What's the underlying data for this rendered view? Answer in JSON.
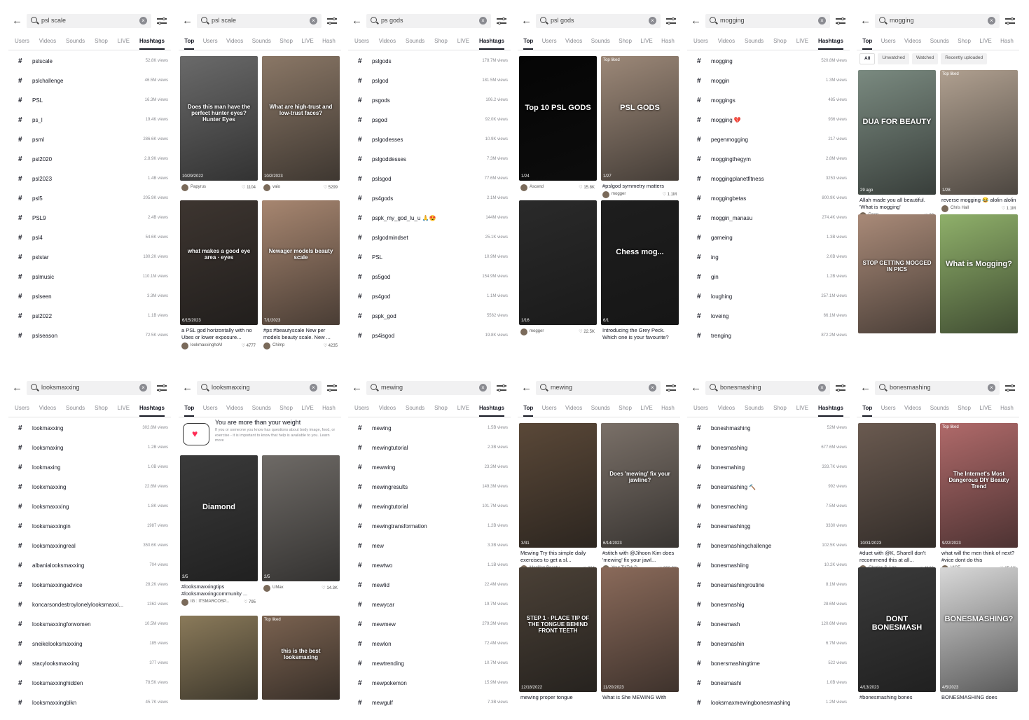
{
  "panels": [
    {
      "query": "psl scale",
      "tabs": [
        "Users",
        "Videos",
        "Sounds",
        "Shop",
        "LIVE",
        "Hashtags"
      ],
      "active": "Hashtags",
      "type": "hashtags",
      "rows": [
        [
          "pslscale",
          "52.8K views"
        ],
        [
          "pslchallenge",
          "46.5M views"
        ],
        [
          "PSL",
          "16.3M views"
        ],
        [
          "ps_l",
          "19.4K views"
        ],
        [
          "psml",
          "286.6K views"
        ],
        [
          "psl2020",
          "2.8.9K views"
        ],
        [
          "psl2023",
          "1.4B views"
        ],
        [
          "psl5",
          "205.9K views"
        ],
        [
          "PSL9",
          "2.4B views"
        ],
        [
          "psl4",
          "54.6K views"
        ],
        [
          "pslstar",
          "180.2K views"
        ],
        [
          "pslmusic",
          "110.1M views"
        ],
        [
          "pslseen",
          "3.3M views"
        ],
        [
          "psl2022",
          "1.1B views"
        ],
        [
          "pslseason",
          "72.5K views"
        ]
      ]
    },
    {
      "query": "psl scale",
      "tabs": [
        "Top",
        "Users",
        "Videos",
        "Sounds",
        "Shop",
        "LIVE",
        "Hash"
      ],
      "active": "Top",
      "type": "top",
      "cards": [
        {
          "ov": "Does this man have the perfect hunter eyes? Hunter Eyes",
          "date": "10/29/2022",
          "cap": "",
          "author": "Papyrus",
          "likes": "1104",
          "bg": "#6a6a6a"
        },
        {
          "ov": "What are high-trust and low-trust faces?",
          "date": "10/2/2023",
          "cap": "",
          "author": "vaio",
          "likes": "5299",
          "bg": "#8a7766"
        },
        {
          "ov": "what makes a good eye area · eyes",
          "date": "6/15/2023",
          "cap": "a PSL god horizontally with no Ubes or lower exposure...",
          "author": "lookmaxxinghoM",
          "likes": "4777",
          "bg": "#3d3530"
        },
        {
          "ov": "Newager models beauty scale",
          "date": "7/1/2023",
          "cap": "#ps #beautyscale New per models beauty scale. New ...",
          "author": "Chimp",
          "likes": "4235",
          "bg": "#a78670"
        }
      ]
    },
    {
      "query": "ps gods",
      "tabs": [
        "Users",
        "Videos",
        "Sounds",
        "Shop",
        "LIVE",
        "Hashtags"
      ],
      "active": "Hashtags",
      "type": "hashtags",
      "rows": [
        [
          "pslgods",
          "178.7M views"
        ],
        [
          "pslgod",
          "181.5M views"
        ],
        [
          "psgods",
          "106.2 views"
        ],
        [
          "psgod",
          "92.0K views"
        ],
        [
          "pslgodesses",
          "10.9K views"
        ],
        [
          "pslgoddesses",
          "7.3M views"
        ],
        [
          "pslsgod",
          "77.6M views"
        ],
        [
          "ps4gods",
          "2.1M views"
        ],
        [
          "pspk_my_god_lu_u 🙏😍",
          "144M views"
        ],
        [
          "pslgodmindset",
          "25.1K views"
        ],
        [
          "PSL",
          "10.9M views"
        ],
        [
          "ps5god",
          "154.9M views"
        ],
        [
          "ps4god",
          "1.1M views"
        ],
        [
          "pspk_god",
          "5562 views"
        ],
        [
          "ps4isgod",
          "19.8K views"
        ]
      ]
    },
    {
      "query": "psl gods",
      "tabs": [
        "Top",
        "Users",
        "Videos",
        "Sounds",
        "Shop",
        "LIVE",
        "Hash"
      ],
      "active": "Top",
      "type": "top",
      "cards": [
        {
          "ov": "Top 10 PSL GODS",
          "date": "1/24",
          "cap": "",
          "author": "Ascend",
          "likes": "15.8K",
          "bg": "#050505"
        },
        {
          "ov": "PSL GODS",
          "date": "1/27",
          "cap": "#pslgod symmetry matters",
          "author": "mogger",
          "likes": "1.1M",
          "bg": "#9c8878",
          "top": "Top liked"
        },
        {
          "ov": "",
          "date": "1/16",
          "cap": "",
          "author": "mogger",
          "likes": "22.5K",
          "bg": "#2a2a2a"
        },
        {
          "ov": "Chess mog...",
          "date": "6/1",
          "cap": "Introducing the Grey Peck. Which one is your favourite?",
          "author": "",
          "likes": "",
          "bg": "#1e1e1e"
        }
      ]
    },
    {
      "query": "mogging",
      "tabs": [
        "Users",
        "Videos",
        "Sounds",
        "Shop",
        "LIVE",
        "Hashtags"
      ],
      "active": "Hashtags",
      "type": "hashtags",
      "rows": [
        [
          "mogging",
          "520.8M views"
        ],
        [
          "moggin",
          "1.3M views"
        ],
        [
          "moggings",
          "485 views"
        ],
        [
          "mogging 💔",
          "936 views"
        ],
        [
          "pegenmogging",
          "217 views"
        ],
        [
          "moggingthegym",
          "2.8M views"
        ],
        [
          "moggingplanetfitness",
          "3253 views"
        ],
        [
          "moggingbetas",
          "800.9K views"
        ],
        [
          "moggin_manasu",
          "274.4K views"
        ],
        [
          "gameing",
          "1.3B views"
        ],
        [
          "ing",
          "2.0B views"
        ],
        [
          "gin",
          "1.2B views"
        ],
        [
          "loughing",
          "257.1M views"
        ],
        [
          "loveing",
          "66.1M views"
        ],
        [
          "trenging",
          "872.2M views"
        ]
      ]
    },
    {
      "query": "mogging",
      "tabs": [
        "Top",
        "Users",
        "Videos",
        "Sounds",
        "Shop",
        "LIVE",
        "Hash"
      ],
      "active": "Top",
      "type": "top",
      "chips": [
        "All",
        "Unwatched",
        "Watched",
        "Recently uploaded"
      ],
      "cards": [
        {
          "ov": "DUA FOR BEAUTY",
          "date": "29 ago",
          "cap": "Allah made you all beautiful. 'What is mogging'",
          "author": "Deen",
          "likes": "22",
          "bg": "#7a8a80"
        },
        {
          "ov": "",
          "date": "1/28",
          "cap": "reverse mogging 😂 alolin alolin",
          "author": "Chris Hall",
          "likes": "1.1M",
          "bg": "#b0a090",
          "top": "Top liked"
        },
        {
          "ov": "STOP GETTING MOGGED IN PICS",
          "date": "",
          "cap": "",
          "author": "",
          "likes": "",
          "bg": "#a98a78"
        },
        {
          "ov": "What is Mogging?",
          "date": "",
          "cap": "",
          "author": "",
          "likes": "",
          "bg": "#8fb06a"
        }
      ]
    },
    {
      "query": "looksmaxxing",
      "tabs": [
        "Users",
        "Videos",
        "Sounds",
        "Shop",
        "LIVE",
        "Hashtags"
      ],
      "active": "Hashtags",
      "type": "hashtags",
      "rows": [
        [
          "lookmaxxing",
          "302.6M views"
        ],
        [
          "looksmaxing",
          "1.2B views"
        ],
        [
          "lookmaxing",
          "1.0B views"
        ],
        [
          "lookxmaxxing",
          "22.6M views"
        ],
        [
          "looksmaxxxing",
          "1.8K views"
        ],
        [
          "looksmaxxingin",
          "1987 views"
        ],
        [
          "looksmaxxingreal",
          "350.6K views"
        ],
        [
          "albanialooksmaxxing",
          "704 views"
        ],
        [
          "looksmaxxingadvice",
          "28.2K views"
        ],
        [
          "koncarsondestroylonelylooksmaxxi...",
          "1362 views"
        ],
        [
          "looksmaxxingforwomen",
          "10.5M views"
        ],
        [
          "sneikelooksmaxxing",
          "185 views"
        ],
        [
          "stacylooksmaxxing",
          "377 views"
        ],
        [
          "looksmaxxinghidden",
          "78.5K views"
        ],
        [
          "looksmaxxingblkn",
          "45.7K views"
        ]
      ]
    },
    {
      "query": "looksmaxxing",
      "tabs": [
        "Top",
        "Users",
        "Videos",
        "Sounds",
        "Shop",
        "LIVE",
        "Hash"
      ],
      "active": "Top",
      "type": "top",
      "weight": [
        "You are more than your weight",
        "If you or someone you know has questions about body image, food, or exercise - it is important to know that help is available to you. Learn more"
      ],
      "cards": [
        {
          "ov": "Diamond",
          "date": "3/5",
          "cap": "#looksmaxxingtips #looksmaxxingcommunity ...",
          "author": "IG : ITSMARCOSP...",
          "likes": "795",
          "bg": "#3a3a3a"
        },
        {
          "ov": "",
          "date": "2/5",
          "cap": "",
          "author": "UMax",
          "likes": "14.3K",
          "bg": "#6e6a66"
        },
        {
          "ov": "",
          "date": "",
          "cap": "",
          "author": "",
          "likes": "",
          "bg": "#8a7a5a"
        },
        {
          "ov": "this is the best looksmaxing",
          "date": "",
          "cap": "",
          "author": "",
          "likes": "",
          "bg": "#7a6250",
          "top": "Top liked"
        }
      ]
    },
    {
      "query": "mewing",
      "tabs": [
        "Users",
        "Videos",
        "Sounds",
        "Shop",
        "LIVE",
        "Hashtags"
      ],
      "active": "Hashtags",
      "type": "hashtags",
      "rows": [
        [
          "mewing",
          "1.5B views"
        ],
        [
          "mewingtutorial",
          "2.3B views"
        ],
        [
          "mewwing",
          "23.3M views"
        ],
        [
          "mewingresults",
          "149.3M views"
        ],
        [
          "mewingtutorial",
          "101.7M views"
        ],
        [
          "mewingtransformation",
          "1.2B views"
        ],
        [
          "mew",
          "3.3B views"
        ],
        [
          "mewtwo",
          "1.1B views"
        ],
        [
          "mewlid",
          "22.4M views"
        ],
        [
          "mewycar",
          "19.7M views"
        ],
        [
          "mewmew",
          "279.3M views"
        ],
        [
          "mewlon",
          "72.4M views"
        ],
        [
          "mewtrending",
          "10.7M views"
        ],
        [
          "mewpokemon",
          "15.9M views"
        ],
        [
          "mewgulf",
          "7.3B views"
        ]
      ]
    },
    {
      "query": "mewing",
      "tabs": [
        "Top",
        "Users",
        "Videos",
        "Sounds",
        "Shop",
        "LIVE",
        "Hash"
      ],
      "active": "Top",
      "type": "top",
      "cards": [
        {
          "ov": "",
          "date": "3/31",
          "cap": "Mewing Try this simple daily exercises to get a sl...",
          "author": "Magillan Beauty...",
          "likes": "234",
          "bg": "#5a4838"
        },
        {
          "ov": "Does 'mewing' fix your jawline?",
          "date": "6/14/2023",
          "cap": "#stitch with @Jihoon Kim does 'mewing' fix your jawl...",
          "author": "Your TikTok D...",
          "likes": "306.9K",
          "bg": "#7a7068"
        },
        {
          "ov": "STEP 1 · PLACE TIP OF THE TONGUE BEHIND FRONT TEETH",
          "date": "12/18/2022",
          "cap": "mewing proper tongue",
          "author": "",
          "likes": "",
          "bg": "#4a4036"
        },
        {
          "ov": "",
          "date": "11/20/2023",
          "cap": "What is She MEWING With",
          "author": "",
          "likes": "",
          "bg": "#8a6a5a"
        }
      ]
    },
    {
      "query": "bonesmashing",
      "tabs": [
        "Users",
        "Videos",
        "Sounds",
        "Shop",
        "LIVE",
        "Hashtags"
      ],
      "active": "Hashtags",
      "type": "hashtags",
      "rows": [
        [
          "boneshmashing",
          "52M views"
        ],
        [
          "bonesmashing",
          "677.6M views"
        ],
        [
          "bonesmahing",
          "333.7K views"
        ],
        [
          "bonesmashing 🔨",
          "992 views"
        ],
        [
          "bonesmaching",
          "7.5M views"
        ],
        [
          "bonesmashingg",
          "3330 views"
        ],
        [
          "bonesmashingchallenge",
          "102.5K views"
        ],
        [
          "bonesmashiing",
          "10.2K views"
        ],
        [
          "bonesmashingroutine",
          "8.1M views"
        ],
        [
          "bonesmashig",
          "28.6M views"
        ],
        [
          "bonesmash",
          "120.6M views"
        ],
        [
          "bonesmashin",
          "6.7M views"
        ],
        [
          "bonersmashingtime",
          "522 views"
        ],
        [
          "bonesmashi",
          "1.0B views"
        ],
        [
          "looksmaxmewingbonesmashing",
          "1.2M views"
        ]
      ]
    },
    {
      "query": "bonesmashing",
      "tabs": [
        "Top",
        "Users",
        "Videos",
        "Sounds",
        "Shop",
        "LIVE",
        "Hash"
      ],
      "active": "Top",
      "type": "top",
      "cards": [
        {
          "ov": "",
          "date": "10/31/2023",
          "cap": "#duet with @K, Sharell don't recommend this at all...",
          "author": "Charles S. Loo...",
          "likes": "4166",
          "bg": "#6a5a50"
        },
        {
          "ov": "The Internet's Most Dangerous DIY Beauty Trend",
          "date": "9/22/2023",
          "cap": "what will the men think of next? #vice dont do this",
          "author": "VICE",
          "likes": "15.1K",
          "bg": "#b06a6a",
          "top": "Top liked"
        },
        {
          "ov": "DONT BONESMASH",
          "date": "4/13/2023",
          "cap": "#bonesmashing bones",
          "author": "",
          "likes": "",
          "bg": "#3a3a3a"
        },
        {
          "ov": "BONESMASHING?",
          "date": "4/5/2023",
          "cap": "BONESMASHING does",
          "author": "",
          "likes": "",
          "bg": "#d8d8d8"
        }
      ]
    }
  ]
}
